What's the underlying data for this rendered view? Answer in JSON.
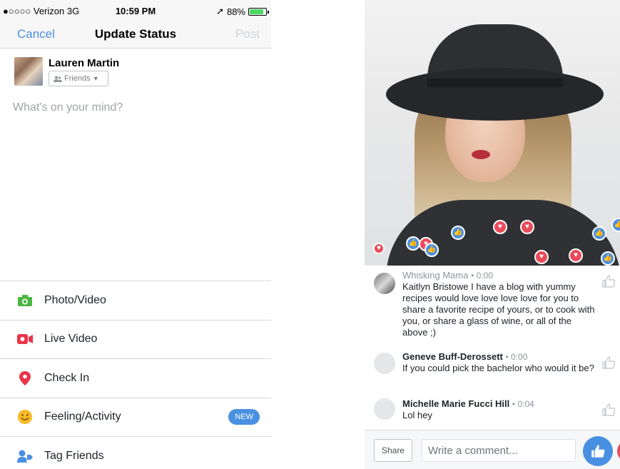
{
  "status_bar": {
    "carrier": "●○○○○ Verizon  3G",
    "time": "10:59 PM",
    "battery": "88%",
    "battery_level": 0.88
  },
  "composer": {
    "cancel_label": "Cancel",
    "title": "Update Status",
    "post_label": "Post",
    "user_name": "Lauren Martin",
    "audience": "Friends",
    "placeholder": "What's on your mind?"
  },
  "actions": [
    {
      "label": "Photo/Video",
      "icon": "camera-icon",
      "color": "#4bb543"
    },
    {
      "label": "Live Video",
      "icon": "live-video-icon",
      "color": "#e9344a"
    },
    {
      "label": "Check In",
      "icon": "location-pin-icon",
      "color": "#e9344a"
    },
    {
      "label": "Feeling/Activity",
      "icon": "smiley-icon",
      "color": "#f7b928",
      "badge": "NEW"
    },
    {
      "label": "Tag Friends",
      "icon": "tag-friends-icon",
      "color": "#4a90e2"
    }
  ],
  "live": {
    "comments": [
      {
        "name": "Whisking Mama",
        "time": "0:00",
        "text": "Kaitlyn Bristowe I have a blog with yummy recipes would love love love love for you to share a favorite recipe of yours, or to cook with you, or share a glass of wine, or all of the above ;)"
      },
      {
        "name": "Geneve Buff-Derossett",
        "time": "0:00",
        "text": "If you could pick the bachelor who would it be?"
      },
      {
        "name": "Michelle Marie Fucci Hill",
        "time": "0:04",
        "text": "Lol hey"
      }
    ],
    "share_label": "Share",
    "comment_placeholder": "Write a comment..."
  },
  "colors": {
    "brand_blue": "#4a90e2",
    "love_red": "#e94b5b",
    "like_blue": "#4a90e2"
  }
}
